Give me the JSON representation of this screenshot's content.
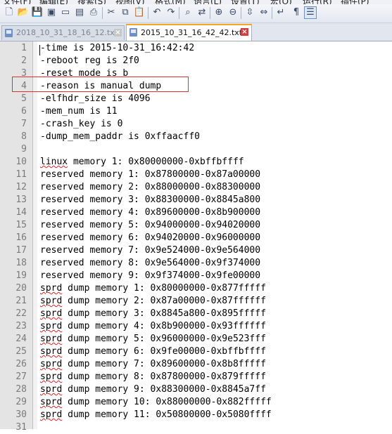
{
  "menu": {
    "items": [
      "文件(F)",
      "编辑(E)",
      "搜索(S)",
      "视图(V)",
      "格式(M)",
      "语言(L)",
      "设置(T)",
      "宏(O)",
      "运行(R)",
      "插件(P)"
    ]
  },
  "toolbar": {
    "icons": [
      "new-file-icon",
      "open-file-icon",
      "save-icon",
      "save-all-icon",
      "close-icon",
      "close-all-icon",
      "print-icon",
      "cut-icon",
      "copy-icon",
      "paste-icon",
      "undo-icon",
      "redo-icon",
      "find-icon",
      "replace-icon",
      "zoom-in-icon",
      "zoom-out-icon",
      "sync-v-icon",
      "sync-h-icon",
      "word-wrap-icon",
      "show-all-chars-icon",
      "indent-guide-icon"
    ]
  },
  "tabs": [
    {
      "label": "2018_10_31_18_16_12.txt",
      "active": false
    },
    {
      "label": "2015_10_31_16_42_42.txt",
      "active": true
    }
  ],
  "editor": {
    "lines": [
      "-time is 2015-10-31_16:42:42",
      "-reboot reg is 2f0",
      "-reset mode is b",
      "-reason is manual dump",
      "-elfhdr_size is 4096",
      "-mem_num is 11",
      "-crash_key is 0",
      "-dump_mem_paddr is 0xffaacff0",
      "",
      "linux memory 1: 0x80000000-0xbffbffff",
      "reserved memory 1: 0x87800000-0x87a00000",
      "reserved memory 2: 0x88000000-0x88300000",
      "reserved memory 3: 0x88300000-0x8845a800",
      "reserved memory 4: 0x89600000-0x8b900000",
      "reserved memory 5: 0x94000000-0x94020000",
      "reserved memory 6: 0x94020000-0x96000000",
      "reserved memory 7: 0x9e524000-0x9e564000",
      "reserved memory 8: 0x9e564000-0x9f374000",
      "reserved memory 9: 0x9f374000-0x9fe00000",
      "sprd dump memory 1: 0x80000000-0x877fffff",
      "sprd dump memory 2: 0x87a00000-0x87ffffff",
      "sprd dump memory 3: 0x8845a800-0x895fffff",
      "sprd dump memory 4: 0x8b900000-0x93ffffff",
      "sprd dump memory 5: 0x96000000-0x9e523fff",
      "sprd dump memory 6: 0x9fe00000-0xbffbffff",
      "sprd dump memory 7: 0x89600000-0x8b8fffff",
      "sprd dump memory 8: 0x87800000-0x879fffff",
      "sprd dump memory 9: 0x88300000-0x8845a7ff",
      "sprd dump memory 10: 0x88000000-0x882fffff",
      "sprd dump memory 11: 0x50800000-0x5080ffff",
      ""
    ],
    "highlighted_line": 4
  }
}
